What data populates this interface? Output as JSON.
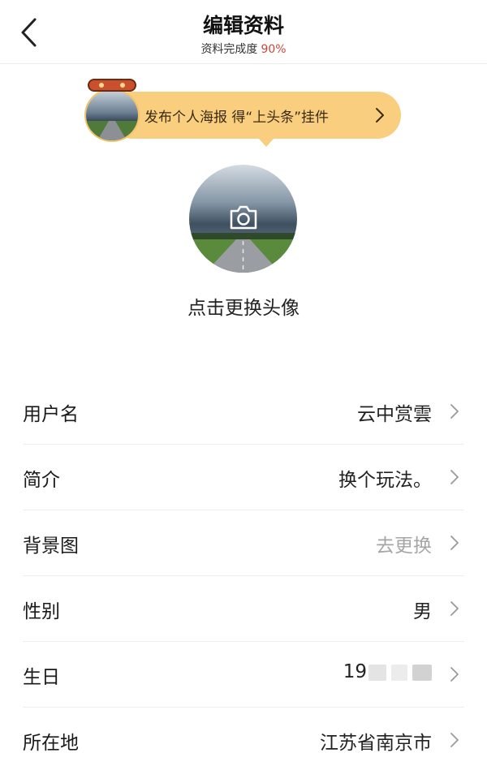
{
  "header": {
    "title": "编辑资料",
    "completion_label": "资料完成度",
    "completion_value": "90%"
  },
  "promo": {
    "text": "发布个人海报 得“上头条”挂件"
  },
  "avatar": {
    "caption": "点击更换头像"
  },
  "rows": [
    {
      "label": "用户名",
      "value": "云中赏雲"
    },
    {
      "label": "简介",
      "value": "换个玩法。"
    },
    {
      "label": "背景图",
      "value": "去更换"
    },
    {
      "label": "性别",
      "value": "男"
    },
    {
      "label": "生日",
      "value": "19"
    },
    {
      "label": "所在地",
      "value": "江苏省南京市"
    }
  ],
  "colors": {
    "accent": "#c8473a",
    "promo_bg": "#f9cf7f",
    "muted_text": "#a6a6a6"
  }
}
